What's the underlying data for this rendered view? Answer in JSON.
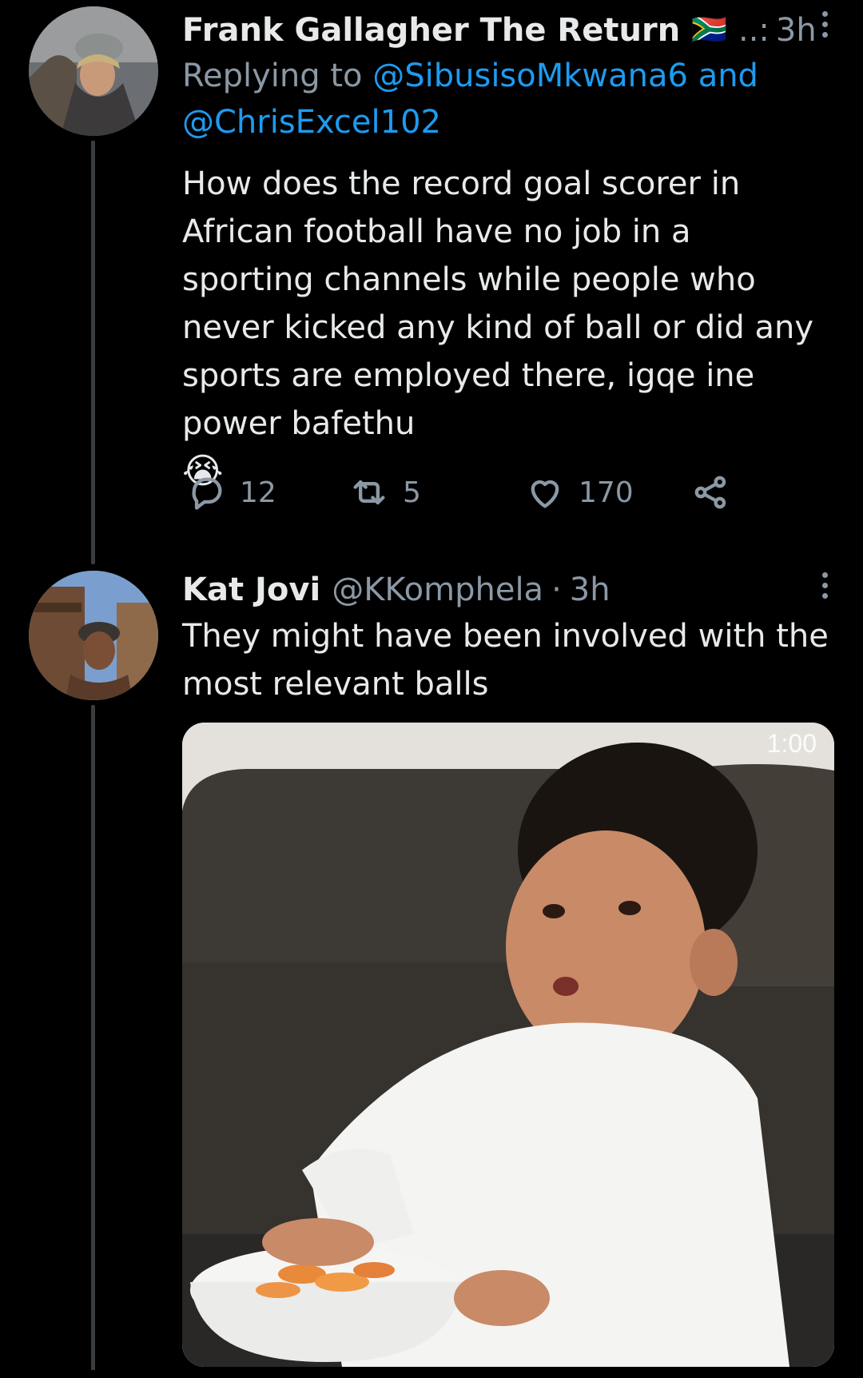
{
  "tweets": [
    {
      "display_name": "Frank Gallagher The Return",
      "flag": "🇿🇦",
      "handle_truncated": "..:",
      "time": "3h",
      "replying_label": "Replying to",
      "mention_1": "@SibusisoMkwana6",
      "and_label": "and",
      "mention_2": "@ChrisExcel102",
      "text": "How does the record goal scorer in African football have no job in a sporting channels while people who never kicked any kind of ball or did any sports are employed there, igqe ine power bafethu",
      "emoji": "😭",
      "reply_count": "12",
      "retweet_count": "5",
      "like_count": "170"
    },
    {
      "display_name": "Kat Jovi",
      "handle": "@KKomphela",
      "separator": "·",
      "time": "3h",
      "text": "They might have been involved with the most relevant balls",
      "video_duration": "1:00"
    }
  ],
  "colors": {
    "background": "#000000",
    "text": "#e7e9ea",
    "secondary": "#8b98a5",
    "link": "#1d9bf0"
  }
}
